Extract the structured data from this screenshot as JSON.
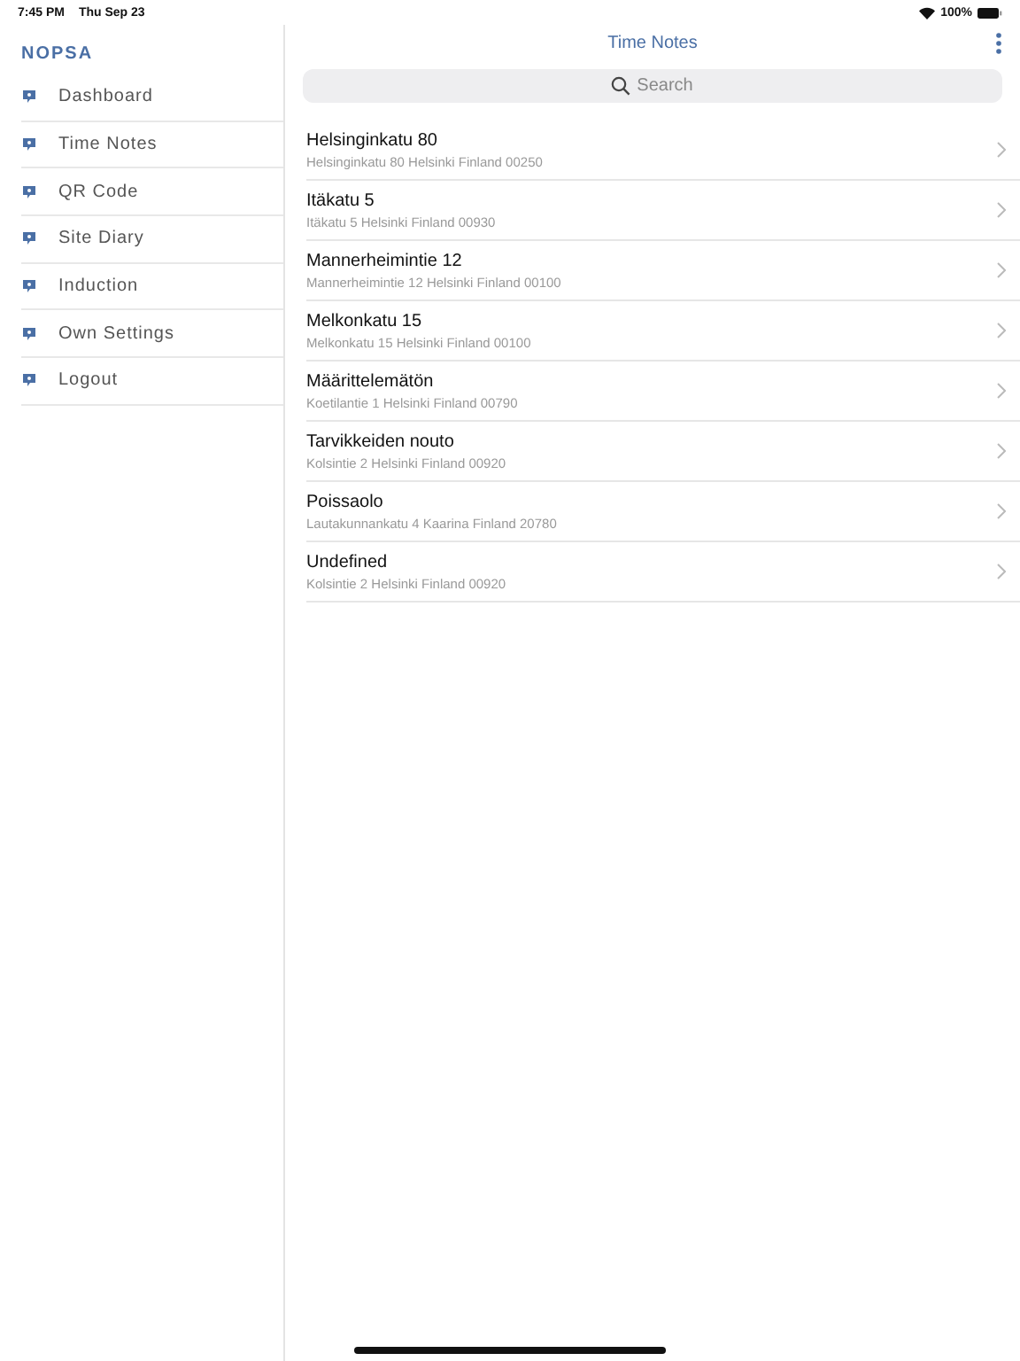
{
  "status_bar": {
    "time": "7:45 PM",
    "date": "Thu Sep 23",
    "battery": "100%"
  },
  "sidebar": {
    "title": "NOPSA",
    "items": [
      {
        "label": "Dashboard"
      },
      {
        "label": "Time Notes"
      },
      {
        "label": "QR Code"
      },
      {
        "label": "Site Diary"
      },
      {
        "label": "Induction"
      },
      {
        "label": "Own Settings"
      },
      {
        "label": "Logout"
      }
    ]
  },
  "header": {
    "title": "Time Notes"
  },
  "search": {
    "placeholder": "Search"
  },
  "list": [
    {
      "title": "Helsinginkatu 80",
      "address": "Helsinginkatu 80 Helsinki Finland 00250"
    },
    {
      "title": "Itäkatu 5",
      "address": "Itäkatu 5 Helsinki Finland 00930"
    },
    {
      "title": "Mannerheimintie 12",
      "address": "Mannerheimintie 12 Helsinki Finland 00100"
    },
    {
      "title": "Melkonkatu 15",
      "address": "Melkonkatu 15 Helsinki Finland 00100"
    },
    {
      "title": "Määrittelemätön",
      "address": "Koetilantie 1 Helsinki Finland 00790"
    },
    {
      "title": "Tarvikkeiden nouto",
      "address": "Kolsintie 2 Helsinki Finland 00920"
    },
    {
      "title": "Poissaolo",
      "address": "Lautakunnankatu 4 Kaarina Finland 20780"
    },
    {
      "title": "Undefined",
      "address": "Kolsintie 2 Helsinki Finland 00920"
    }
  ]
}
